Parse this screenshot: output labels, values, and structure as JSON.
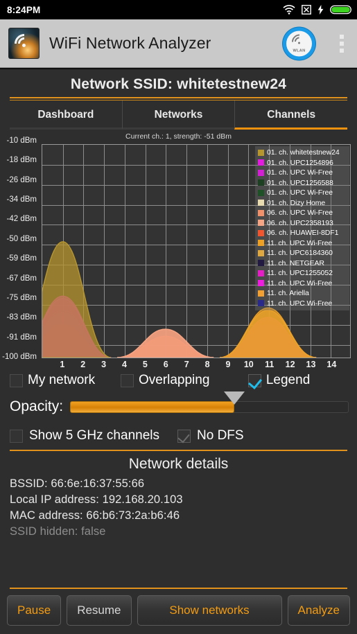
{
  "statusbar": {
    "time": "8:24PM",
    "icons": [
      "wifi-icon",
      "no-sim-icon",
      "charging-bolt-icon",
      "battery-icon"
    ]
  },
  "appbar": {
    "title": "WiFi Network Analyzer",
    "logo": "app-logo-icon",
    "wlan_button": "WLAN",
    "overflow": "overflow-menu-icon"
  },
  "header": {
    "ssid_title": "Network SSID: whitetestnew24"
  },
  "tabs": [
    {
      "label": "Dashboard",
      "active": false
    },
    {
      "label": "Networks",
      "active": false
    },
    {
      "label": "Channels",
      "active": true
    }
  ],
  "chart_data": {
    "type": "area",
    "title": "Current ch.: 1, strength: -51 dBm",
    "xlabel": "",
    "ylabel": "dBm",
    "xlim": [
      0,
      15
    ],
    "ylim": [
      -100,
      -10
    ],
    "grid": true,
    "legend_position": "top-right",
    "x_ticks": [
      "1",
      "2",
      "3",
      "4",
      "5",
      "6",
      "7",
      "8",
      "9",
      "10",
      "11",
      "12",
      "13",
      "14"
    ],
    "y_ticks": [
      "-10 dBm",
      "-18 dBm",
      "-26 dBm",
      "-34 dBm",
      "-42 dBm",
      "-50 dBm",
      "-59 dBm",
      "-67 dBm",
      "-75 dBm",
      "-83 dBm",
      "-91 dBm",
      "-100 dBm"
    ],
    "series": [
      {
        "name": "01. ch. whitetestnew24",
        "channel": 1,
        "color": "#b8962e",
        "level": -51
      },
      {
        "name": "01. ch. UPC1254896",
        "channel": 1,
        "color": "#e31ce0",
        "level": -74
      },
      {
        "name": "01. ch. UPC Wi-Free",
        "channel": 1,
        "color": "#d41fd4",
        "level": -75
      },
      {
        "name": "01. ch. UPC1256588",
        "channel": 1,
        "color": "#1d4022",
        "level": -80
      },
      {
        "name": "01. ch. UPC Wi-Free",
        "channel": 1,
        "color": "#1e5226",
        "level": -81
      },
      {
        "name": "01. ch. Dizy Home",
        "channel": 1,
        "color": "#e8dbb0",
        "level": -86
      },
      {
        "name": "06. ch. UPC Wi-Free",
        "channel": 6,
        "color": "#f0916b",
        "level": -88
      },
      {
        "name": "06. ch. UPC2358193",
        "channel": 6,
        "color": "#f5a584",
        "level": -88
      },
      {
        "name": "06. ch. HUAWEI-8DF1",
        "channel": 6,
        "color": "#f2562e",
        "level": -91
      },
      {
        "name": "11. ch. UPC Wi-Free",
        "channel": 11,
        "color": "#eda024",
        "level": -79
      },
      {
        "name": "11. ch. UPC6184360",
        "channel": 11,
        "color": "#e0a840",
        "level": -80
      },
      {
        "name": "11. ch. NETGEAR",
        "channel": 11,
        "color": "#221a42",
        "level": -83
      },
      {
        "name": "11. ch. UPC1255052",
        "channel": 11,
        "color": "#e51ec6",
        "level": -83
      },
      {
        "name": "11. ch. UPC Wi-Free",
        "channel": 11,
        "color": "#ef1de0",
        "level": -84
      },
      {
        "name": "11. ch. Ariella",
        "channel": 11,
        "color": "#f2a031",
        "level": -85
      },
      {
        "name": "11. ch. UPC Wi-Free",
        "channel": 11,
        "color": "#2a2a8c",
        "level": -86
      }
    ]
  },
  "chart_options": [
    {
      "label": "My network",
      "checked": false,
      "style": "bare"
    },
    {
      "label": "Overlapping",
      "checked": false,
      "style": "bare"
    },
    {
      "label": "Legend",
      "checked": true,
      "style": "checked"
    }
  ],
  "opacity": {
    "label": "Opacity:",
    "value_percent": 59
  },
  "band_options": [
    {
      "label": "Show 5 GHz channels",
      "checked": false,
      "style": "bare"
    },
    {
      "label": "No DFS",
      "checked": true,
      "style": "dim"
    }
  ],
  "details": {
    "title": "Network details",
    "lines": [
      "BSSID: 66:6e:16:37:55:66",
      "Local IP address: 192.168.20.103",
      "MAC address: 66:b6:73:2a:b6:46",
      "SSID hidden: false"
    ]
  },
  "buttons": [
    {
      "label": "Pause",
      "accent": "#f39c12"
    },
    {
      "label": "Resume",
      "accent": "#d7d7d7"
    },
    {
      "label": "Show networks",
      "accent": "#f39c12"
    },
    {
      "label": "Analyze",
      "accent": "#f39c12"
    }
  ],
  "colors": {
    "accent": "#f0920e",
    "panel": "#2e2e2e",
    "plot_bg": "#333333"
  }
}
